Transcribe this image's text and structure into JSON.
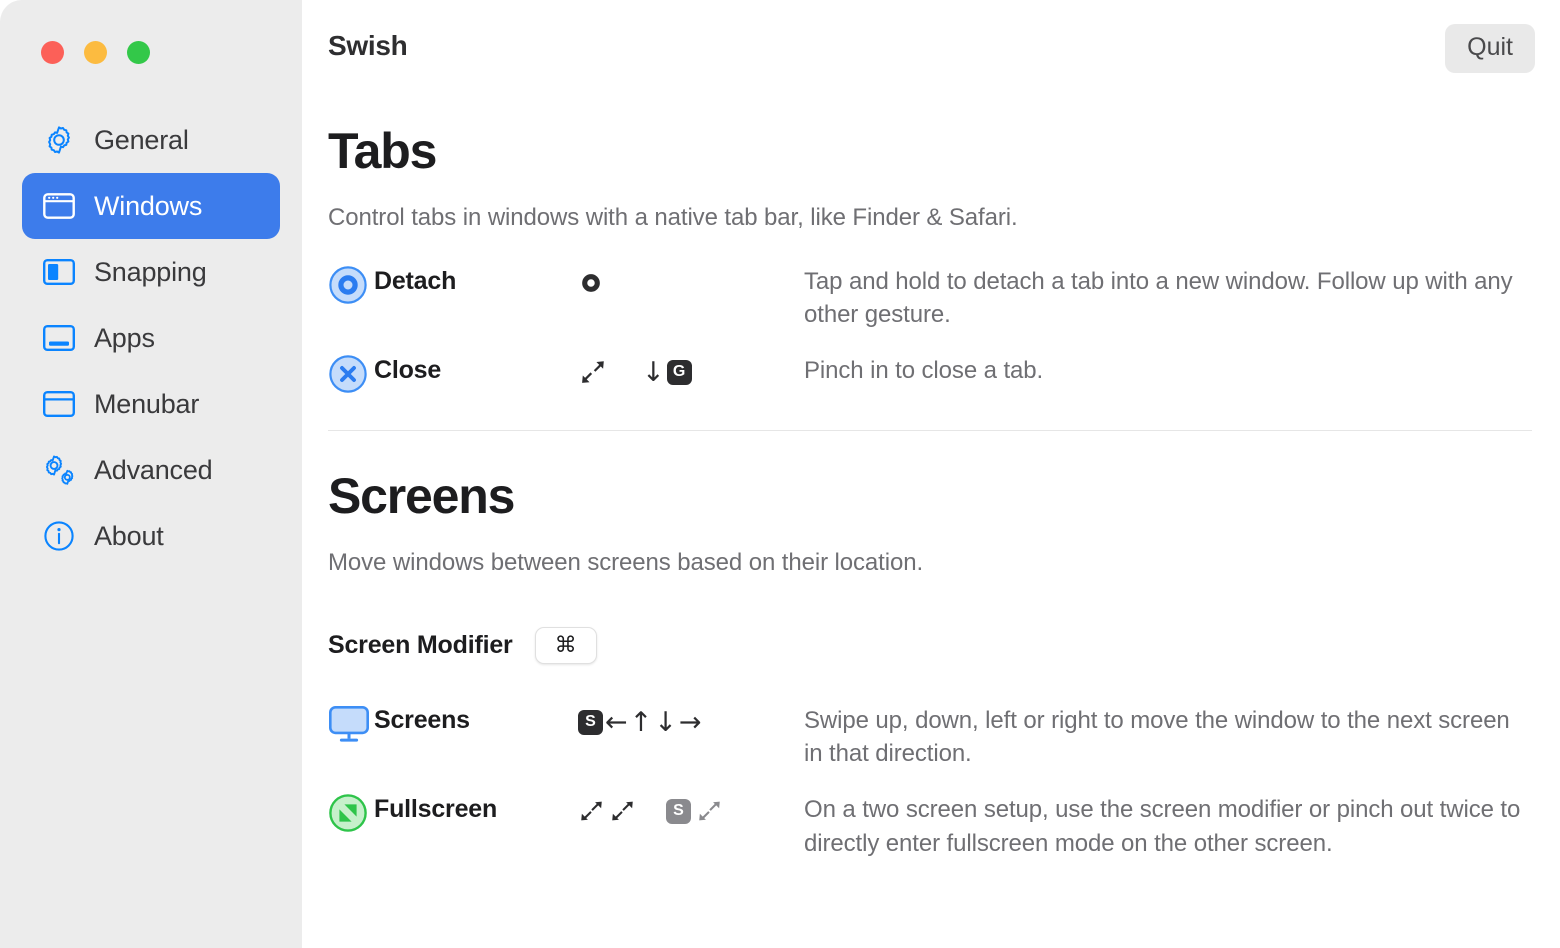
{
  "window": {
    "traffic_lights": [
      {
        "name": "close",
        "color": "#fc6058"
      },
      {
        "name": "minimize",
        "color": "#fcbb40"
      },
      {
        "name": "maximize",
        "color": "#33c849"
      }
    ]
  },
  "sidebar": {
    "items": [
      {
        "label": "General",
        "icon": "gear-icon",
        "selected": false
      },
      {
        "label": "Windows",
        "icon": "window-icon",
        "selected": true
      },
      {
        "label": "Snapping",
        "icon": "split-window-icon",
        "selected": false
      },
      {
        "label": "Apps",
        "icon": "app-window-icon",
        "selected": false
      },
      {
        "label": "Menubar",
        "icon": "menubar-window-icon",
        "selected": false
      },
      {
        "label": "Advanced",
        "icon": "double-gear-icon",
        "selected": false
      },
      {
        "label": "About",
        "icon": "info-circle-icon",
        "selected": false
      }
    ],
    "selected_accent": "#3d7ceb",
    "background": "#ececec"
  },
  "header": {
    "title": "Swish",
    "quit_label": "Quit"
  },
  "sections": [
    {
      "id": "tabs",
      "title": "Tabs",
      "description": "Control tabs in windows with a native tab bar, like Finder & Safari.",
      "rows": [
        {
          "icon": "detach-circle-icon",
          "name": "Detach",
          "gestures": [
            {
              "type": "tap-hold-ring",
              "tone": "dark"
            }
          ],
          "description": "Tap and hold to detach a tab into a new window. Follow up with any other gesture."
        },
        {
          "icon": "close-circle-icon",
          "name": "Close",
          "gestures": [
            {
              "type": "pinch-in-arrows",
              "tone": "dark"
            },
            {
              "type": "arrow-down-key",
              "arrow": "↓",
              "key": "G",
              "tone": "dark"
            }
          ],
          "description": "Pinch in to close a tab."
        }
      ]
    },
    {
      "id": "screens",
      "title": "Screens",
      "description": "Move windows between screens based on their location.",
      "modifier": {
        "label": "Screen Modifier",
        "value": "⌘"
      },
      "rows": [
        {
          "icon": "display-icon",
          "name": "Screens",
          "gestures": [
            {
              "type": "key-arrows",
              "key": "S",
              "arrows": [
                "←",
                "↑",
                "↓",
                "→"
              ],
              "tone": "dark"
            }
          ],
          "description": "Swipe up, down, left or right to move the window to the next screen in that direction."
        },
        {
          "icon": "fullscreen-green-icon",
          "name": "Fullscreen",
          "gestures": [
            {
              "type": "pinch-out-double",
              "tone": "dark"
            },
            {
              "type": "key-pinch-out",
              "key": "S",
              "tone": "gray"
            }
          ],
          "description": "On a two screen setup, use the screen modifier or pinch out twice to directly enter fullscreen mode on the other screen."
        }
      ]
    }
  ]
}
